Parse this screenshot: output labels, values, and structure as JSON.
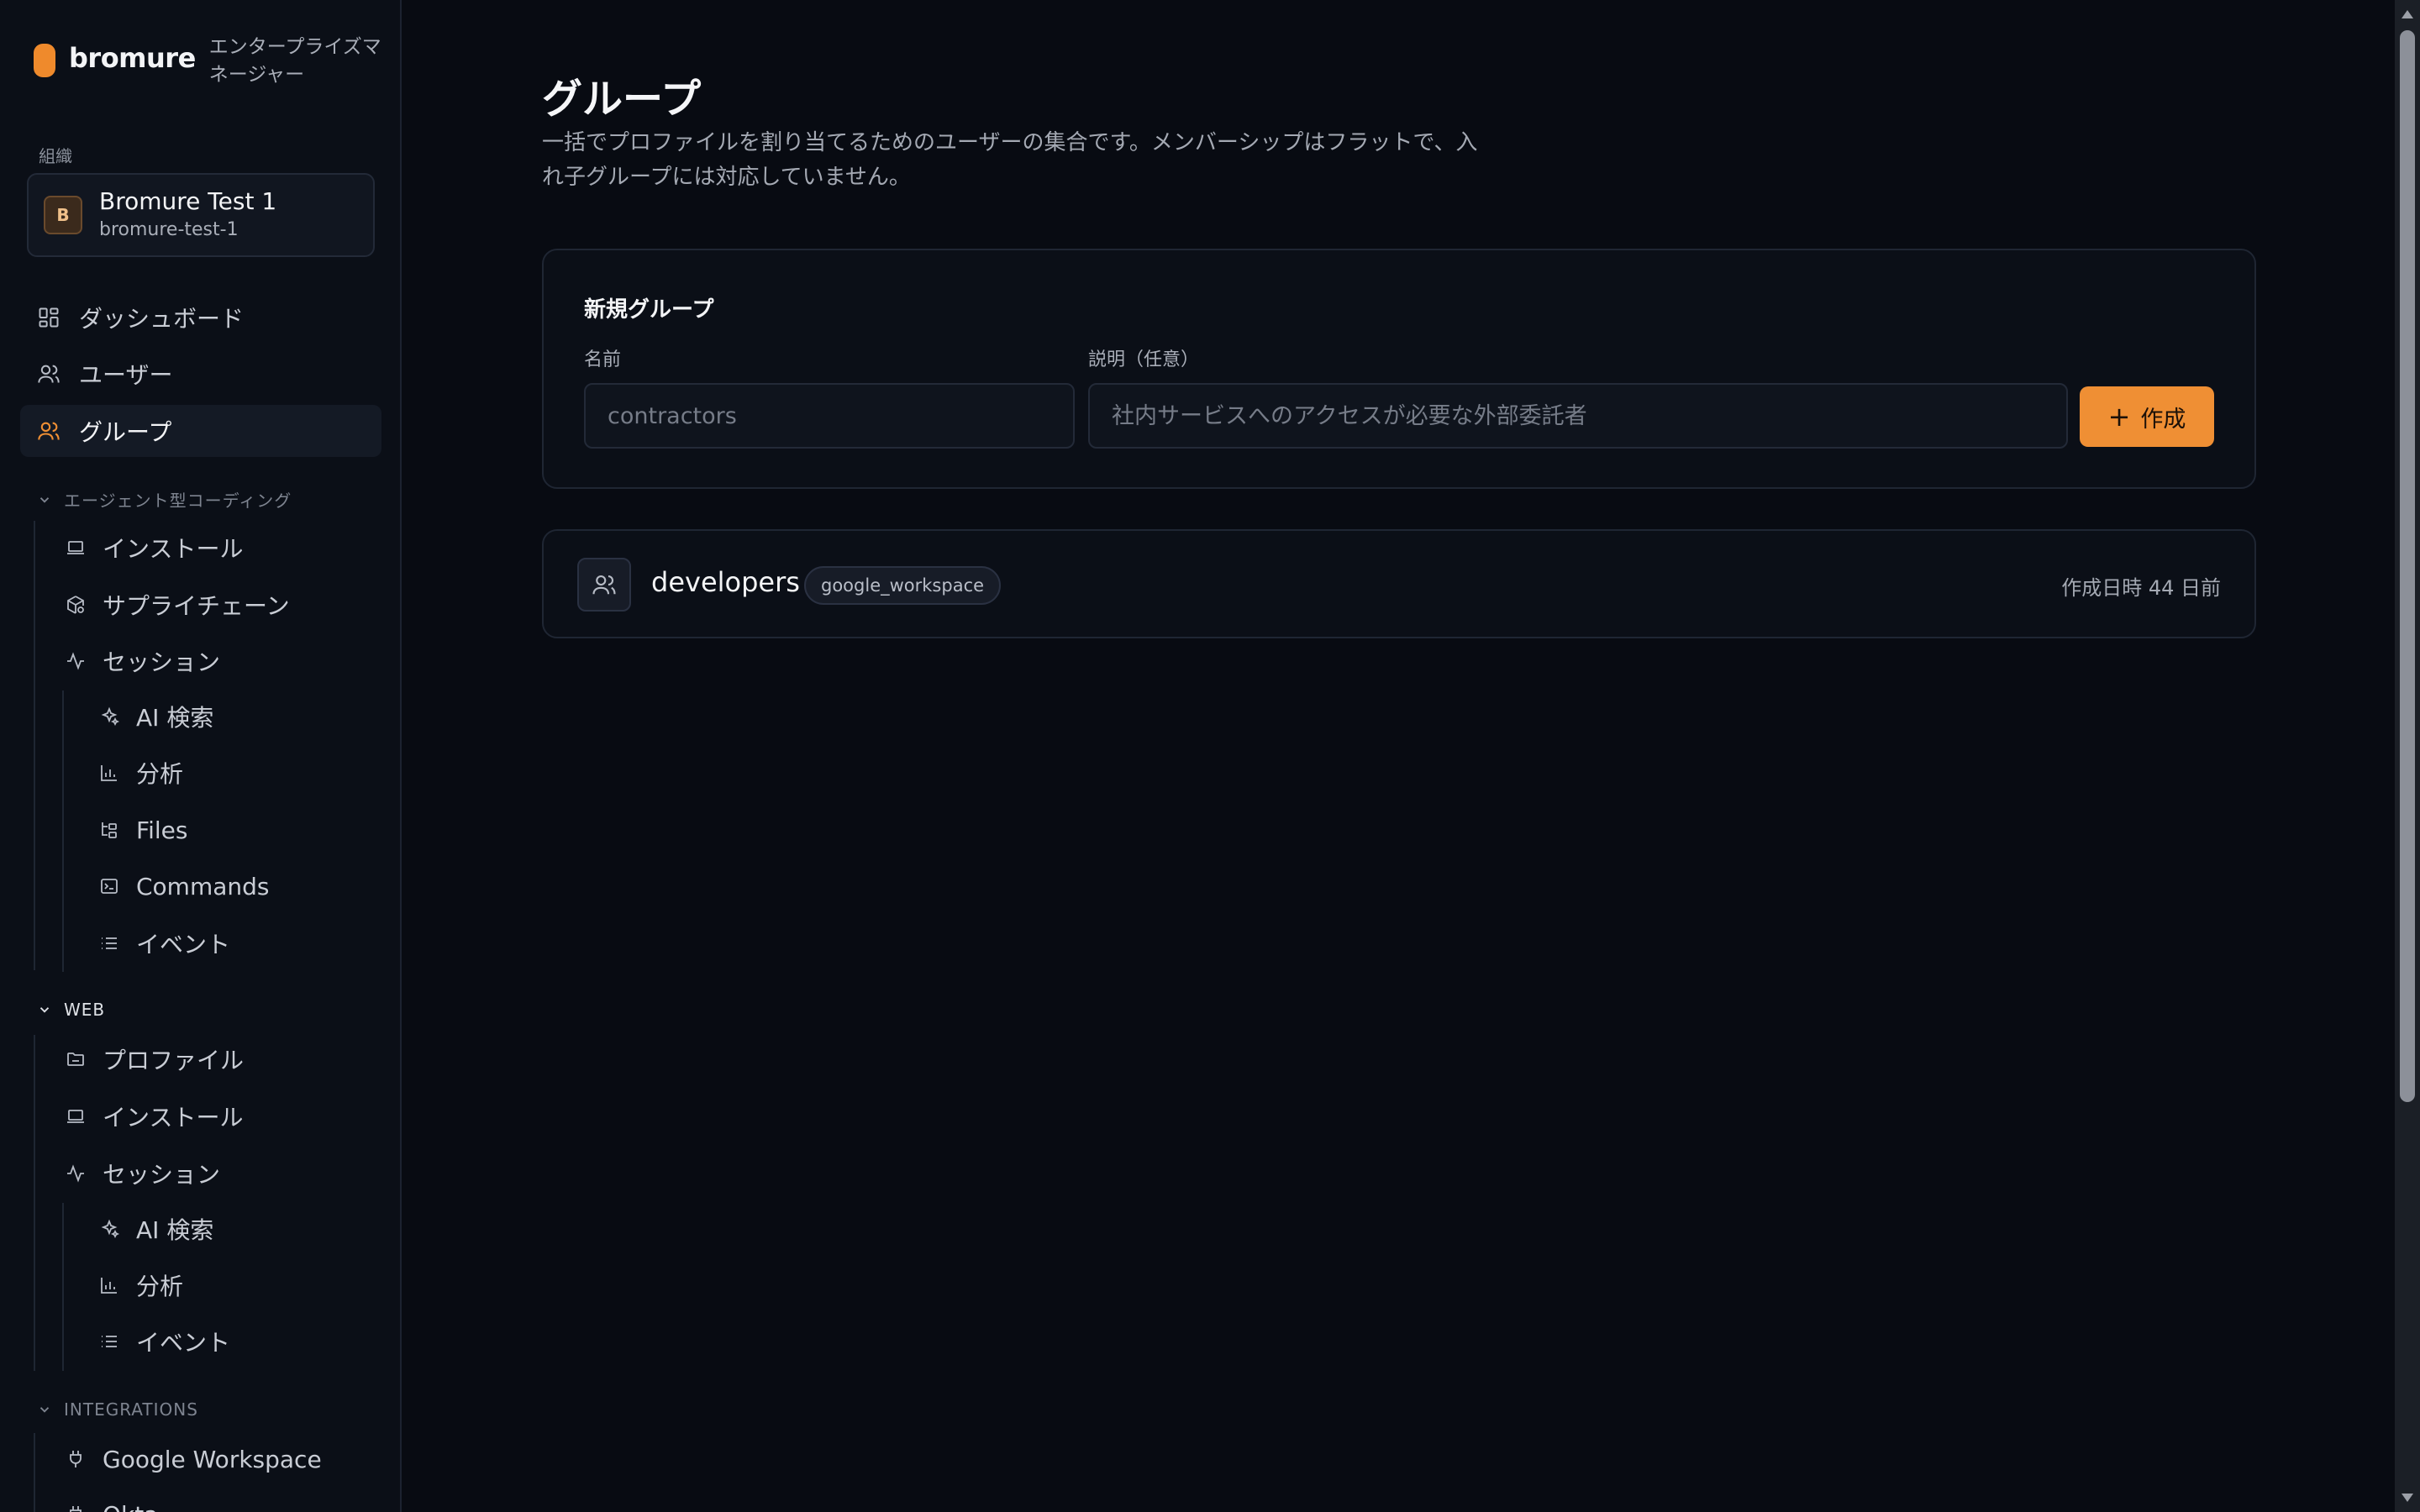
{
  "brand": {
    "name": "bromure",
    "tagline": "エンタープライズマネージャー"
  },
  "org": {
    "section_label": "組織",
    "avatar_letter": "B",
    "name": "Bromure Test 1",
    "slug": "bromure-test-1"
  },
  "nav": {
    "dashboard": "ダッシュボード",
    "users": "ユーザー",
    "groups": "グループ"
  },
  "sections": {
    "agentic": {
      "label": "エージェント型コーディング",
      "install": "インストール",
      "supply_chain": "サプライチェーン",
      "sessions": "セッション",
      "ai_search": "AI 検索",
      "analytics": "分析",
      "files": "Files",
      "commands": "Commands",
      "events": "イベント"
    },
    "web": {
      "label": "WEB",
      "profiles": "プロファイル",
      "install": "インストール",
      "sessions": "セッション",
      "ai_search": "AI 検索",
      "analytics": "分析",
      "events": "イベント"
    },
    "integrations": {
      "label": "INTEGRATIONS",
      "google_workspace": "Google Workspace",
      "next_item": "Okta"
    }
  },
  "page": {
    "title": "グループ",
    "description": "一括でプロファイルを割り当てるためのユーザーの集合です。メンバーシップはフラットで、入れ子グループには対応していません。"
  },
  "new_group": {
    "title": "新規グループ",
    "name_label": "名前",
    "name_placeholder": "contractors",
    "desc_label": "説明（任意）",
    "desc_placeholder": "社内サービスへのアクセスが必要な外部委託者",
    "create_label": "作成"
  },
  "groups": [
    {
      "name": "developers",
      "source": "google_workspace",
      "created": "作成日時 44 日前"
    }
  ],
  "colors": {
    "accent": "#ef8f34",
    "background": "#080b12",
    "sidebar": "#0b0f17"
  }
}
